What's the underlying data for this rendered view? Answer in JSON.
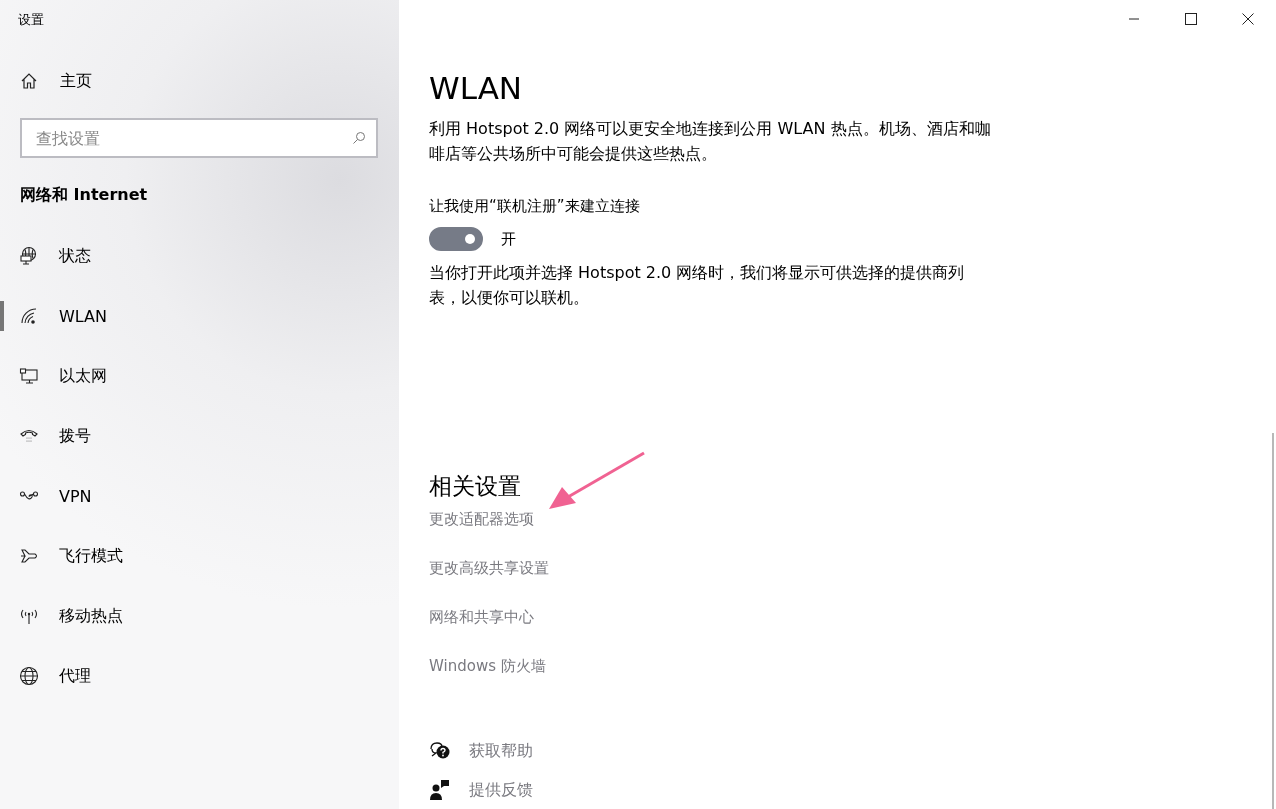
{
  "window": {
    "title": "设置"
  },
  "sidebar": {
    "home": "主页",
    "search": {
      "placeholder": "查找设置"
    },
    "section": "网络和 Internet",
    "items": [
      {
        "label": "状态",
        "selected": false
      },
      {
        "label": "WLAN",
        "selected": true
      },
      {
        "label": "以太网",
        "selected": false
      },
      {
        "label": "拨号",
        "selected": false
      },
      {
        "label": "VPN",
        "selected": false
      },
      {
        "label": "飞行模式",
        "selected": false
      },
      {
        "label": "移动热点",
        "selected": false
      },
      {
        "label": "代理",
        "selected": false
      }
    ]
  },
  "content": {
    "title": "WLAN",
    "description": "利用 Hotspot 2.0 网络可以更安全地连接到公用 WLAN 热点。机场、酒店和咖啡店等公共场所中可能会提供这些热点。",
    "toggle": {
      "label": "让我使用“联机注册”来建立连接",
      "on": true,
      "state_text": "开"
    },
    "note": "当你打开此项并选择 Hotspot 2.0 网络时，我们将显示可供选择的提供商列表，以便你可以联机。",
    "related": {
      "heading": "相关设置",
      "links": [
        "更改适配器选项",
        "更改高级共享设置",
        "网络和共享中心",
        "Windows 防火墙"
      ]
    },
    "help": [
      {
        "label": "获取帮助"
      },
      {
        "label": "提供反馈"
      }
    ]
  }
}
